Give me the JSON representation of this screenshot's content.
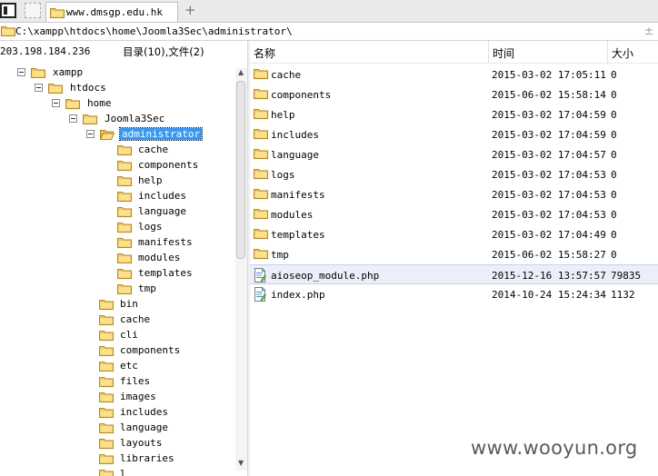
{
  "tab": {
    "title": "www.dmsgp.edu.hk",
    "add_label": "+"
  },
  "path": {
    "value": "C:\\xampp\\htdocs\\home\\Joomla3Sec\\administrator\\",
    "collapse_label": "±"
  },
  "left": {
    "ip": "203.198.184.236",
    "counts": "目录(10),文件(2)",
    "tree": [
      {
        "label": "xampp",
        "icon": "folder-icon",
        "expanded": true
      },
      {
        "label": "htdocs",
        "icon": "folder-icon",
        "expanded": true
      },
      {
        "label": "home",
        "icon": "folder-icon",
        "expanded": true
      },
      {
        "label": "Joomla3Sec",
        "icon": "folder-icon",
        "expanded": true
      },
      {
        "label": "administrator",
        "icon": "folder-open-icon",
        "expanded": true,
        "selected": true
      },
      {
        "label": "cache",
        "icon": "folder-icon"
      },
      {
        "label": "components",
        "icon": "folder-icon"
      },
      {
        "label": "help",
        "icon": "folder-icon"
      },
      {
        "label": "includes",
        "icon": "folder-icon"
      },
      {
        "label": "language",
        "icon": "folder-icon"
      },
      {
        "label": "logs",
        "icon": "folder-icon"
      },
      {
        "label": "manifests",
        "icon": "folder-icon"
      },
      {
        "label": "modules",
        "icon": "folder-icon"
      },
      {
        "label": "templates",
        "icon": "folder-icon"
      },
      {
        "label": "tmp",
        "icon": "folder-icon"
      },
      {
        "label": "bin",
        "icon": "folder-icon"
      },
      {
        "label": "cache",
        "icon": "folder-icon"
      },
      {
        "label": "cli",
        "icon": "folder-icon"
      },
      {
        "label": "components",
        "icon": "folder-icon"
      },
      {
        "label": "etc",
        "icon": "folder-icon"
      },
      {
        "label": "files",
        "icon": "folder-icon"
      },
      {
        "label": "images",
        "icon": "folder-icon"
      },
      {
        "label": "includes",
        "icon": "folder-icon"
      },
      {
        "label": "language",
        "icon": "folder-icon"
      },
      {
        "label": "layouts",
        "icon": "folder-icon"
      },
      {
        "label": "libraries",
        "icon": "folder-icon"
      },
      {
        "label": "l",
        "icon": "folder-icon"
      }
    ],
    "scroll_up": "▲",
    "scroll_down": "▼"
  },
  "list": {
    "columns": {
      "name": "名称",
      "time": "时间",
      "size": "大小"
    },
    "rows": [
      {
        "name": "cache",
        "time": "2015-03-02 17:05:11",
        "size": "0",
        "icon": "folder-icon"
      },
      {
        "name": "components",
        "time": "2015-06-02 15:58:14",
        "size": "0",
        "icon": "folder-icon"
      },
      {
        "name": "help",
        "time": "2015-03-02 17:04:59",
        "size": "0",
        "icon": "folder-icon"
      },
      {
        "name": "includes",
        "time": "2015-03-02 17:04:59",
        "size": "0",
        "icon": "folder-icon"
      },
      {
        "name": "language",
        "time": "2015-03-02 17:04:57",
        "size": "0",
        "icon": "folder-icon"
      },
      {
        "name": "logs",
        "time": "2015-03-02 17:04:53",
        "size": "0",
        "icon": "folder-icon"
      },
      {
        "name": "manifests",
        "time": "2015-03-02 17:04:53",
        "size": "0",
        "icon": "folder-icon"
      },
      {
        "name": "modules",
        "time": "2015-03-02 17:04:53",
        "size": "0",
        "icon": "folder-icon"
      },
      {
        "name": "templates",
        "time": "2015-03-02 17:04:49",
        "size": "0",
        "icon": "folder-icon"
      },
      {
        "name": "tmp",
        "time": "2015-06-02 15:58:27",
        "size": "0",
        "icon": "folder-icon"
      },
      {
        "name": "aioseop_module.php",
        "time": "2015-12-16 13:57:57",
        "size": "79835",
        "icon": "php-file-icon",
        "highlighted": true
      },
      {
        "name": "index.php",
        "time": "2014-10-24 15:24:34",
        "size": "1132",
        "icon": "php-file-icon"
      }
    ]
  },
  "watermark": "www.wooyun.org",
  "colors": {
    "selection": "#3399ff",
    "folder": "#f5c84c",
    "row_highlight": "#eceffa"
  }
}
